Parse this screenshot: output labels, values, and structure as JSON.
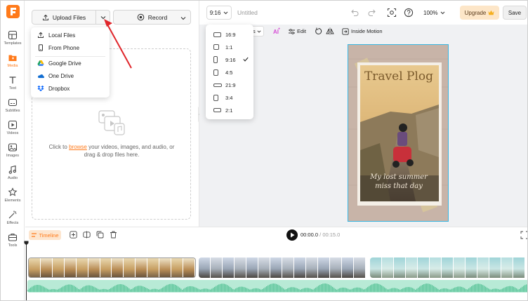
{
  "sidebar": {
    "items": [
      {
        "label": "Templates",
        "icon": "templates-icon"
      },
      {
        "label": "Media",
        "icon": "media-icon",
        "active": true
      },
      {
        "label": "Text",
        "icon": "text-icon"
      },
      {
        "label": "Subtitles",
        "icon": "subtitles-icon"
      },
      {
        "label": "Videos",
        "icon": "videos-icon"
      },
      {
        "label": "Images",
        "icon": "images-icon"
      },
      {
        "label": "Audio",
        "icon": "audio-icon"
      },
      {
        "label": "Elements",
        "icon": "elements-icon"
      },
      {
        "label": "Effects",
        "icon": "effects-icon"
      },
      {
        "label": "Tools",
        "icon": "tools-icon"
      }
    ]
  },
  "panel": {
    "upload_label": "Upload Files",
    "record_label": "Record",
    "dropzone": {
      "prefix": "Click to ",
      "browse": "browse",
      "suffix": " your videos, images, and audio, or drag & drop files here."
    }
  },
  "upload_menu": {
    "items": [
      {
        "label": "Local Files",
        "icon": "upload-icon"
      },
      {
        "label": "From Phone",
        "icon": "phone-icon"
      },
      {
        "label": "Google Drive",
        "icon": "google-drive-icon"
      },
      {
        "label": "One Drive",
        "icon": "onedrive-icon"
      },
      {
        "label": "Dropbox",
        "icon": "dropbox-icon"
      }
    ]
  },
  "topbar": {
    "ratio": "9:16",
    "title": "Untitled",
    "zoom": "100%",
    "upgrade_label": "Upgrade",
    "save_label": "Save"
  },
  "toolbar2": {
    "s_partial": "s",
    "edit_label": "Edit",
    "inside_motion_label": "Inside Motion"
  },
  "ratio_menu": {
    "options": [
      "16:9",
      "1:1",
      "9:16",
      "4:5",
      "21:9",
      "3:4",
      "2:1"
    ],
    "selected": "9:16"
  },
  "canvas": {
    "title_text": "Travel Plog",
    "caption_line1": "My lost summer",
    "caption_line2": "miss that day"
  },
  "timeline": {
    "label": "Timeline",
    "current_time": "00:00.0",
    "separator": "/",
    "total_time": "00:15.0"
  },
  "colors": {
    "accent": "#ff7a1a",
    "selection": "#39b7e3",
    "arrow": "#e0262b",
    "audio": "#b8ead6"
  }
}
